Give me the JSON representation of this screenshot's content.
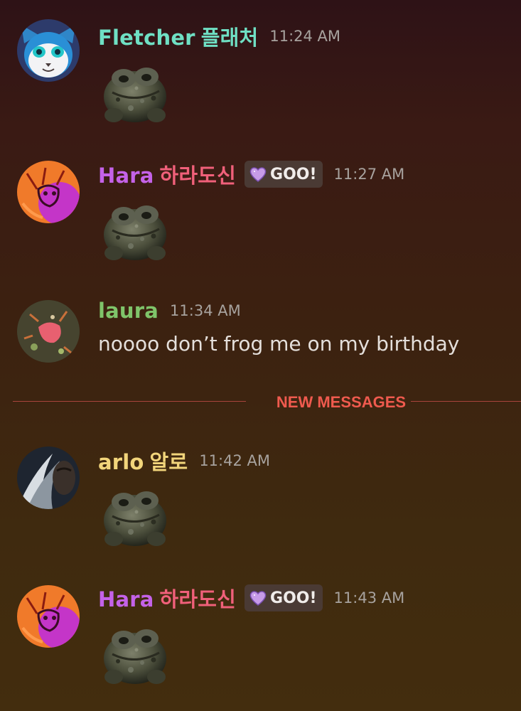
{
  "messages": [
    {
      "user": "Fletcher",
      "user_ko": "플래처",
      "color": "#6fe0c4",
      "time": "11:24 AM",
      "sticker": "frog-sticker"
    },
    {
      "user": "Hara",
      "user_ko": "하라도신",
      "color": "#c462e8",
      "ko_color": "#f0607a",
      "tag": "GOO!",
      "time": "11:27 AM",
      "sticker": "frog-sticker"
    },
    {
      "user": "laura",
      "color": "#7fc46a",
      "time": "11:34 AM",
      "text": "noooo don’t frog me on my birthday"
    },
    {
      "user": "arlo",
      "user_ko": "알로",
      "color": "#f2d57b",
      "time": "11:42 AM",
      "sticker": "frog-sticker"
    },
    {
      "user": "Hara",
      "user_ko": "하라도신",
      "color": "#c462e8",
      "ko_color": "#f0607a",
      "tag": "GOO!",
      "time": "11:43 AM",
      "sticker": "frog-sticker"
    }
  ],
  "divider": {
    "label": "NEW MESSAGES",
    "color": "#ef5a4e"
  }
}
